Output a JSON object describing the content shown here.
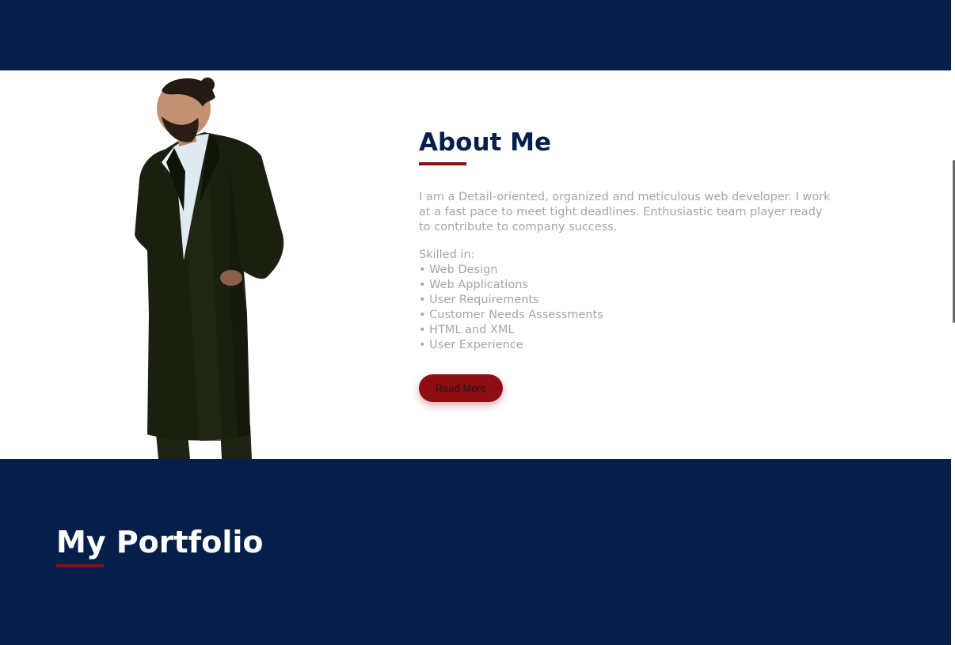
{
  "about": {
    "title": "About Me",
    "intro": "I am a Detail-oriented, organized and meticulous web developer. I work at a fast pace to meet tight deadlines. Enthusiastic team player ready to contribute to company success.",
    "skills_heading": "Skilled in:",
    "skills": [
      "• Web Design",
      "• Web Applications",
      "• User Requirements",
      "• Customer Needs Assessments",
      "• HTML and XML",
      "• User Experience"
    ],
    "read_more_label": "Read More"
  },
  "portfolio": {
    "title": "My Portfolio"
  },
  "colors": {
    "navy": "#051f4a",
    "accent_red": "#8c0d12",
    "body_text": "#a5a5a5"
  }
}
